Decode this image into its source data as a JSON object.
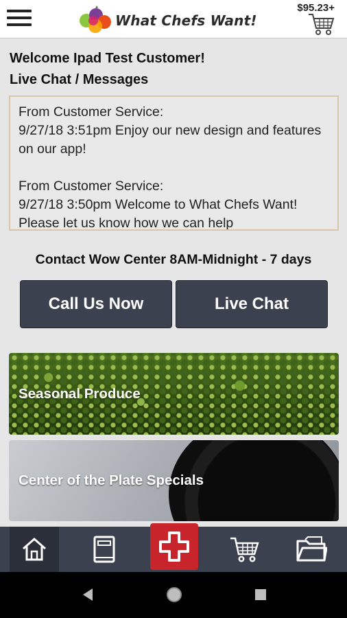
{
  "header": {
    "brand": "What Chefs Want!",
    "cart_total": "$95.23+"
  },
  "welcome_text": "Welcome Ipad Test Customer!",
  "chat_title": "Live Chat / Messages",
  "messages": [
    {
      "sender": "From Customer Service:",
      "body": "9/27/18 3:51pm Enjoy our new design and features on our app!"
    },
    {
      "sender": "From Customer Service:",
      "body": "9/27/18 3:50pm Welcome to What Chefs Want! Please let us know how we can help"
    }
  ],
  "contact_text": "Contact Wow Center 8AM-Midnight - 7 days",
  "buttons": {
    "call": "Call Us Now",
    "chat": "Live Chat"
  },
  "banners": [
    {
      "label": "Seasonal Produce"
    },
    {
      "label": "Center of the Plate Specials"
    }
  ],
  "bottom_nav": [
    "home-icon",
    "catalog-icon",
    "add-icon",
    "cart-icon",
    "orders-icon"
  ],
  "colors": {
    "nav_bg": "#3c4150",
    "accent_red": "#c8242b",
    "button_bg": "#3c4150"
  }
}
